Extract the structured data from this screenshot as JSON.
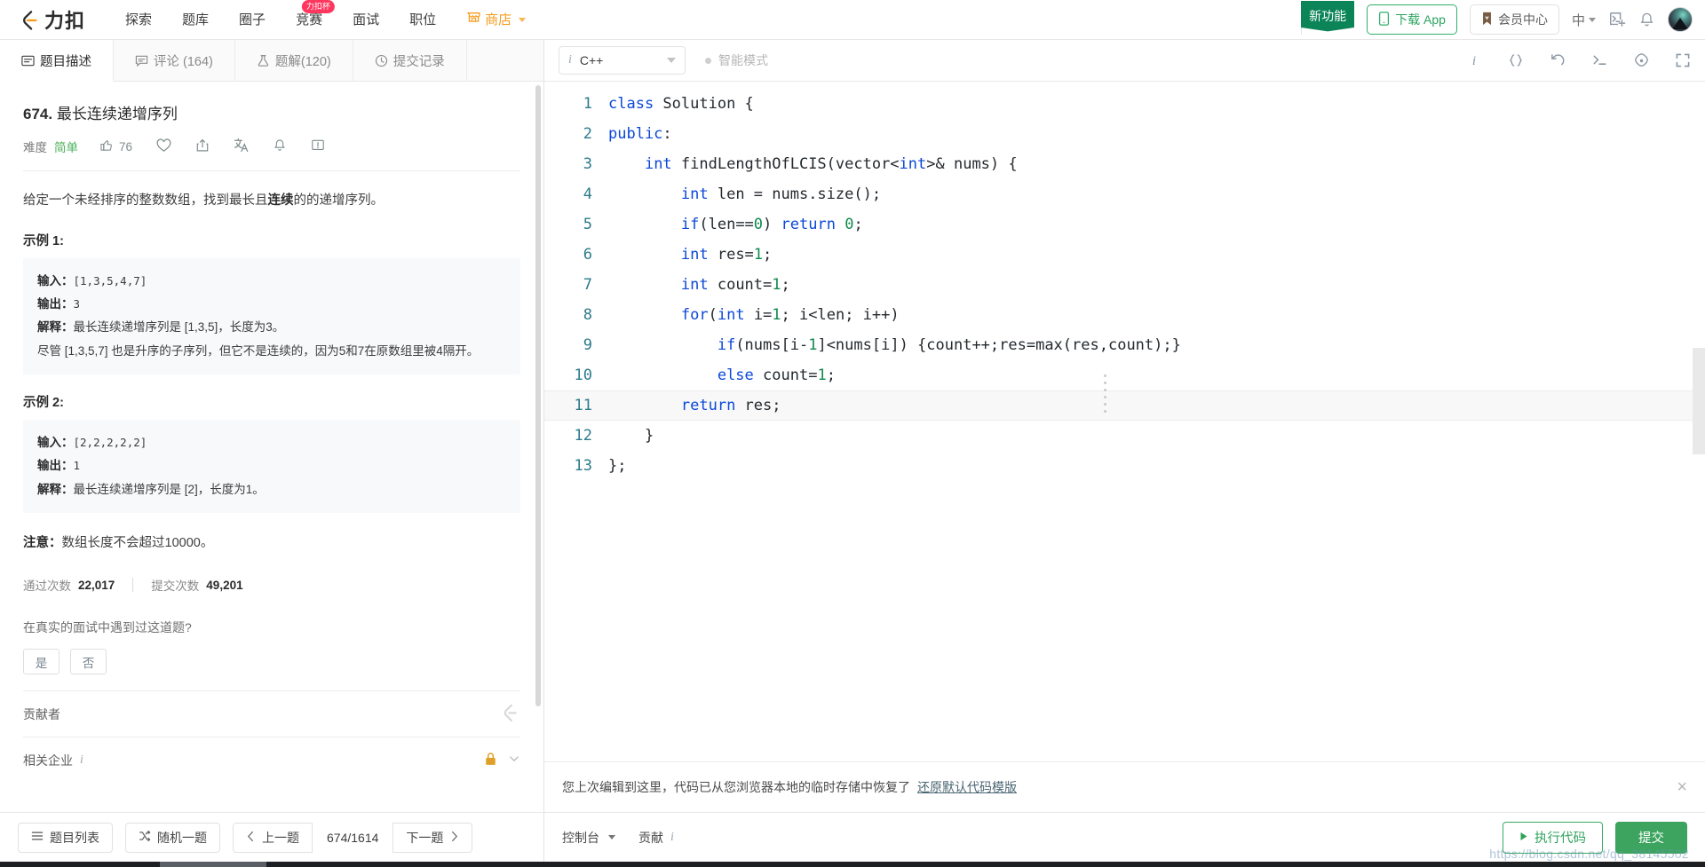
{
  "header": {
    "logo_text": "力扣",
    "nav": [
      {
        "label": "探索",
        "badge": null
      },
      {
        "label": "题库",
        "badge": null
      },
      {
        "label": "圈子",
        "badge": null
      },
      {
        "label": "竞赛",
        "badge": "力扣杯"
      },
      {
        "label": "面试",
        "badge": null
      },
      {
        "label": "职位",
        "badge": null
      }
    ],
    "shop": "商店",
    "ribbon": "新功能",
    "download_app": "下载 App",
    "member_center": "会员中心",
    "language": "中",
    "icons": [
      "terminal-add-icon",
      "bell-icon",
      "avatar"
    ]
  },
  "tabs": [
    {
      "label": "题目描述",
      "icon": "description-icon",
      "active": true
    },
    {
      "label": "评论 (164)",
      "icon": "comment-icon",
      "active": false
    },
    {
      "label": "题解(120)",
      "icon": "flask-icon",
      "active": false
    },
    {
      "label": "提交记录",
      "icon": "clock-icon",
      "active": false
    }
  ],
  "problem": {
    "number": "674.",
    "title": "最长连续递增序列",
    "difficulty_label": "难度",
    "difficulty": "简单",
    "likes": "76",
    "description_pre": "给定一个未经排序的整数数组，找到最长且",
    "description_bold": "连续",
    "description_post": "的的递增序列。",
    "example1_head": "示例 1:",
    "example1": [
      {
        "label": "输入：",
        "value": "[1,3,5,4,7]"
      },
      {
        "label": "输出：",
        "value": "3"
      },
      {
        "label": "解释：",
        "value": "最长连续递增序列是 [1,3,5]，长度为3。"
      }
    ],
    "example1_extra": "尽管 [1,3,5,7] 也是升序的子序列，但它不是连续的，因为5和7在原数组里被4隔开。",
    "example2_head": "示例 2:",
    "example2": [
      {
        "label": "输入：",
        "value": "[2,2,2,2,2]"
      },
      {
        "label": "输出：",
        "value": "1"
      },
      {
        "label": "解释：",
        "value": "最长连续递增序列是 [2]，长度为1。"
      }
    ],
    "note_label": "注意：",
    "note_text": "数组长度不会超过10000。",
    "stats": {
      "accepted_label": "通过次数",
      "accepted_value": "22,017",
      "submitted_label": "提交次数",
      "submitted_value": "49,201"
    },
    "interview_question": "在真实的面试中遇到过这道题?",
    "yes": "是",
    "no": "否",
    "contributors_label": "贡献者",
    "companies_label": "相关企业"
  },
  "left_bottom": {
    "problem_list": "题目列表",
    "random": "随机一题",
    "prev": "上一题",
    "counter": "674/1614",
    "next": "下一题"
  },
  "editor": {
    "language": "C++",
    "smart_mode": "智能模式",
    "tools": [
      "info-icon",
      "braces-icon",
      "undo-icon",
      "terminal-icon",
      "settings-icon",
      "fullscreen-icon"
    ],
    "current_line": 11,
    "lines": [
      {
        "n": "1",
        "tokens": [
          {
            "t": "class ",
            "c": "kw"
          },
          {
            "t": "Solution {",
            "c": ""
          }
        ]
      },
      {
        "n": "2",
        "tokens": [
          {
            "t": "public",
            "c": "kw"
          },
          {
            "t": ":",
            "c": ""
          }
        ]
      },
      {
        "n": "3",
        "tokens": [
          {
            "t": "    ",
            "c": ""
          },
          {
            "t": "int",
            "c": "kw"
          },
          {
            "t": " findLengthOfLCIS(vector<",
            "c": ""
          },
          {
            "t": "int",
            "c": "kw"
          },
          {
            "t": ">& nums) {",
            "c": ""
          }
        ]
      },
      {
        "n": "4",
        "tokens": [
          {
            "t": "        ",
            "c": ""
          },
          {
            "t": "int",
            "c": "kw"
          },
          {
            "t": " len = nums.size();",
            "c": ""
          }
        ]
      },
      {
        "n": "5",
        "tokens": [
          {
            "t": "        ",
            "c": ""
          },
          {
            "t": "if",
            "c": "kw"
          },
          {
            "t": "(len==",
            "c": ""
          },
          {
            "t": "0",
            "c": "num0"
          },
          {
            "t": ") ",
            "c": ""
          },
          {
            "t": "return",
            "c": "kw"
          },
          {
            "t": " ",
            "c": ""
          },
          {
            "t": "0",
            "c": "num0"
          },
          {
            "t": ";",
            "c": ""
          }
        ]
      },
      {
        "n": "6",
        "tokens": [
          {
            "t": "        ",
            "c": ""
          },
          {
            "t": "int",
            "c": "kw"
          },
          {
            "t": " res=",
            "c": ""
          },
          {
            "t": "1",
            "c": "num0"
          },
          {
            "t": ";",
            "c": ""
          }
        ]
      },
      {
        "n": "7",
        "tokens": [
          {
            "t": "        ",
            "c": ""
          },
          {
            "t": "int",
            "c": "kw"
          },
          {
            "t": " count=",
            "c": ""
          },
          {
            "t": "1",
            "c": "num0"
          },
          {
            "t": ";",
            "c": ""
          }
        ]
      },
      {
        "n": "8",
        "tokens": [
          {
            "t": "        ",
            "c": ""
          },
          {
            "t": "for",
            "c": "kw"
          },
          {
            "t": "(",
            "c": ""
          },
          {
            "t": "int",
            "c": "kw"
          },
          {
            "t": " i=",
            "c": ""
          },
          {
            "t": "1",
            "c": "num0"
          },
          {
            "t": "; i<len; i++)",
            "c": ""
          }
        ]
      },
      {
        "n": "9",
        "tokens": [
          {
            "t": "            ",
            "c": ""
          },
          {
            "t": "if",
            "c": "kw"
          },
          {
            "t": "(nums[i-",
            "c": ""
          },
          {
            "t": "1",
            "c": "num0"
          },
          {
            "t": "]<nums[i]) {count++;res=max(res,count);}",
            "c": ""
          }
        ]
      },
      {
        "n": "10",
        "tokens": [
          {
            "t": "            ",
            "c": ""
          },
          {
            "t": "else",
            "c": "kw"
          },
          {
            "t": " count=",
            "c": ""
          },
          {
            "t": "1",
            "c": "num0"
          },
          {
            "t": ";",
            "c": ""
          }
        ]
      },
      {
        "n": "11",
        "tokens": [
          {
            "t": "        ",
            "c": ""
          },
          {
            "t": "return",
            "c": "kw"
          },
          {
            "t": " res;",
            "c": ""
          }
        ]
      },
      {
        "n": "12",
        "tokens": [
          {
            "t": "    }",
            "c": ""
          }
        ]
      },
      {
        "n": "13",
        "tokens": [
          {
            "t": "};",
            "c": ""
          }
        ]
      }
    ]
  },
  "toast": {
    "message": "您上次编辑到这里，代码已从您浏览器本地的临时存储中恢复了",
    "link": "还原默认代码模版",
    "close": "×"
  },
  "right_bottom": {
    "console": "控制台",
    "contribute": "贡献",
    "run": "执行代码",
    "submit": "提交",
    "watermark": "https://blog.csdn.net/qq_38145502"
  },
  "colors": {
    "brand_green": "#3ca45e",
    "orange": "#f79c1e",
    "easy_green": "#4bb25a",
    "badge_pink": "#ff375f",
    "keyword_blue": "#0b48d8",
    "number_green": "#0f8a4f",
    "linenum_teal": "#2d7a8c"
  }
}
